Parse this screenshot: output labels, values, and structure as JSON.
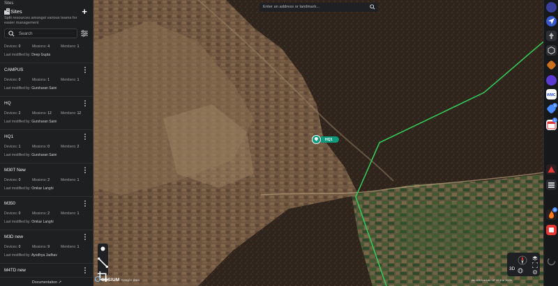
{
  "app": {
    "section_label": "Sites"
  },
  "sites_panel": {
    "title": "Sites",
    "subtitle": "Split resources amongst various teams for easier management",
    "add_icon": "plus-icon",
    "search_placeholder": "Search",
    "filter_icon": "filter-sliders-icon",
    "stat_labels": {
      "devices": "Devices:",
      "missions": "Missions:",
      "members": "Members:",
      "last_modified": "Last modified by:"
    },
    "sites": [
      {
        "name": "",
        "devices": "0",
        "missions": "4",
        "members": "1",
        "last_modified_by": "Deep Gupta",
        "partial": true
      },
      {
        "name": "CAMPUS",
        "devices": "0",
        "missions": "1",
        "members": "1",
        "last_modified_by": "Gursharan Saini"
      },
      {
        "name": "HQ",
        "devices": "2",
        "missions": "12",
        "members": "12",
        "last_modified_by": "Gursharan Saini"
      },
      {
        "name": "HQ1",
        "devices": "1",
        "missions": "0",
        "members": "2",
        "last_modified_by": "Gursharan Saini"
      },
      {
        "name": "M30T New",
        "devices": "0",
        "missions": "2",
        "members": "1",
        "last_modified_by": "Omkar Langhi"
      },
      {
        "name": "M350",
        "devices": "0",
        "missions": "2",
        "members": "1",
        "last_modified_by": "Omkar Langhi"
      },
      {
        "name": "M3D new",
        "devices": "0",
        "missions": "9",
        "members": "1",
        "last_modified_by": "Ayodhya Jadhav"
      },
      {
        "name": "M4TD new",
        "devices": "0",
        "missions": "0",
        "members": "1",
        "last_modified_by": ""
      }
    ],
    "documentation_link": "Documentation"
  },
  "map": {
    "address_placeholder": "Enter an address or landmark...",
    "marker_label": "HQ1",
    "mode_button": "3D",
    "attribution": "CESIUM",
    "attribution_sub": "Google data",
    "scale_text": "Alt: 825.0 m   Lat: 18° 57.9 m   100%",
    "draw_tools": [
      "point-icon",
      "line-icon",
      "polygon-crop-icon"
    ],
    "colors": {
      "boundary_line": "#34c85a",
      "marker": "#0e9b7d"
    }
  },
  "dock": {
    "icons": [
      "user-avatar-icon",
      "send-icon",
      "arrow-up-icon",
      "cube-icon",
      "orange-diamond-icon",
      "globe-icon",
      "wmc-icon",
      "blue-diamond-icon",
      "calendar-icon",
      "red-alert-icon",
      "stack-icon",
      "flame-icon",
      "red-box-icon",
      "spinner-icon"
    ],
    "badges": {
      "calendar": "2",
      "alert": "1",
      "flame": "4"
    }
  }
}
